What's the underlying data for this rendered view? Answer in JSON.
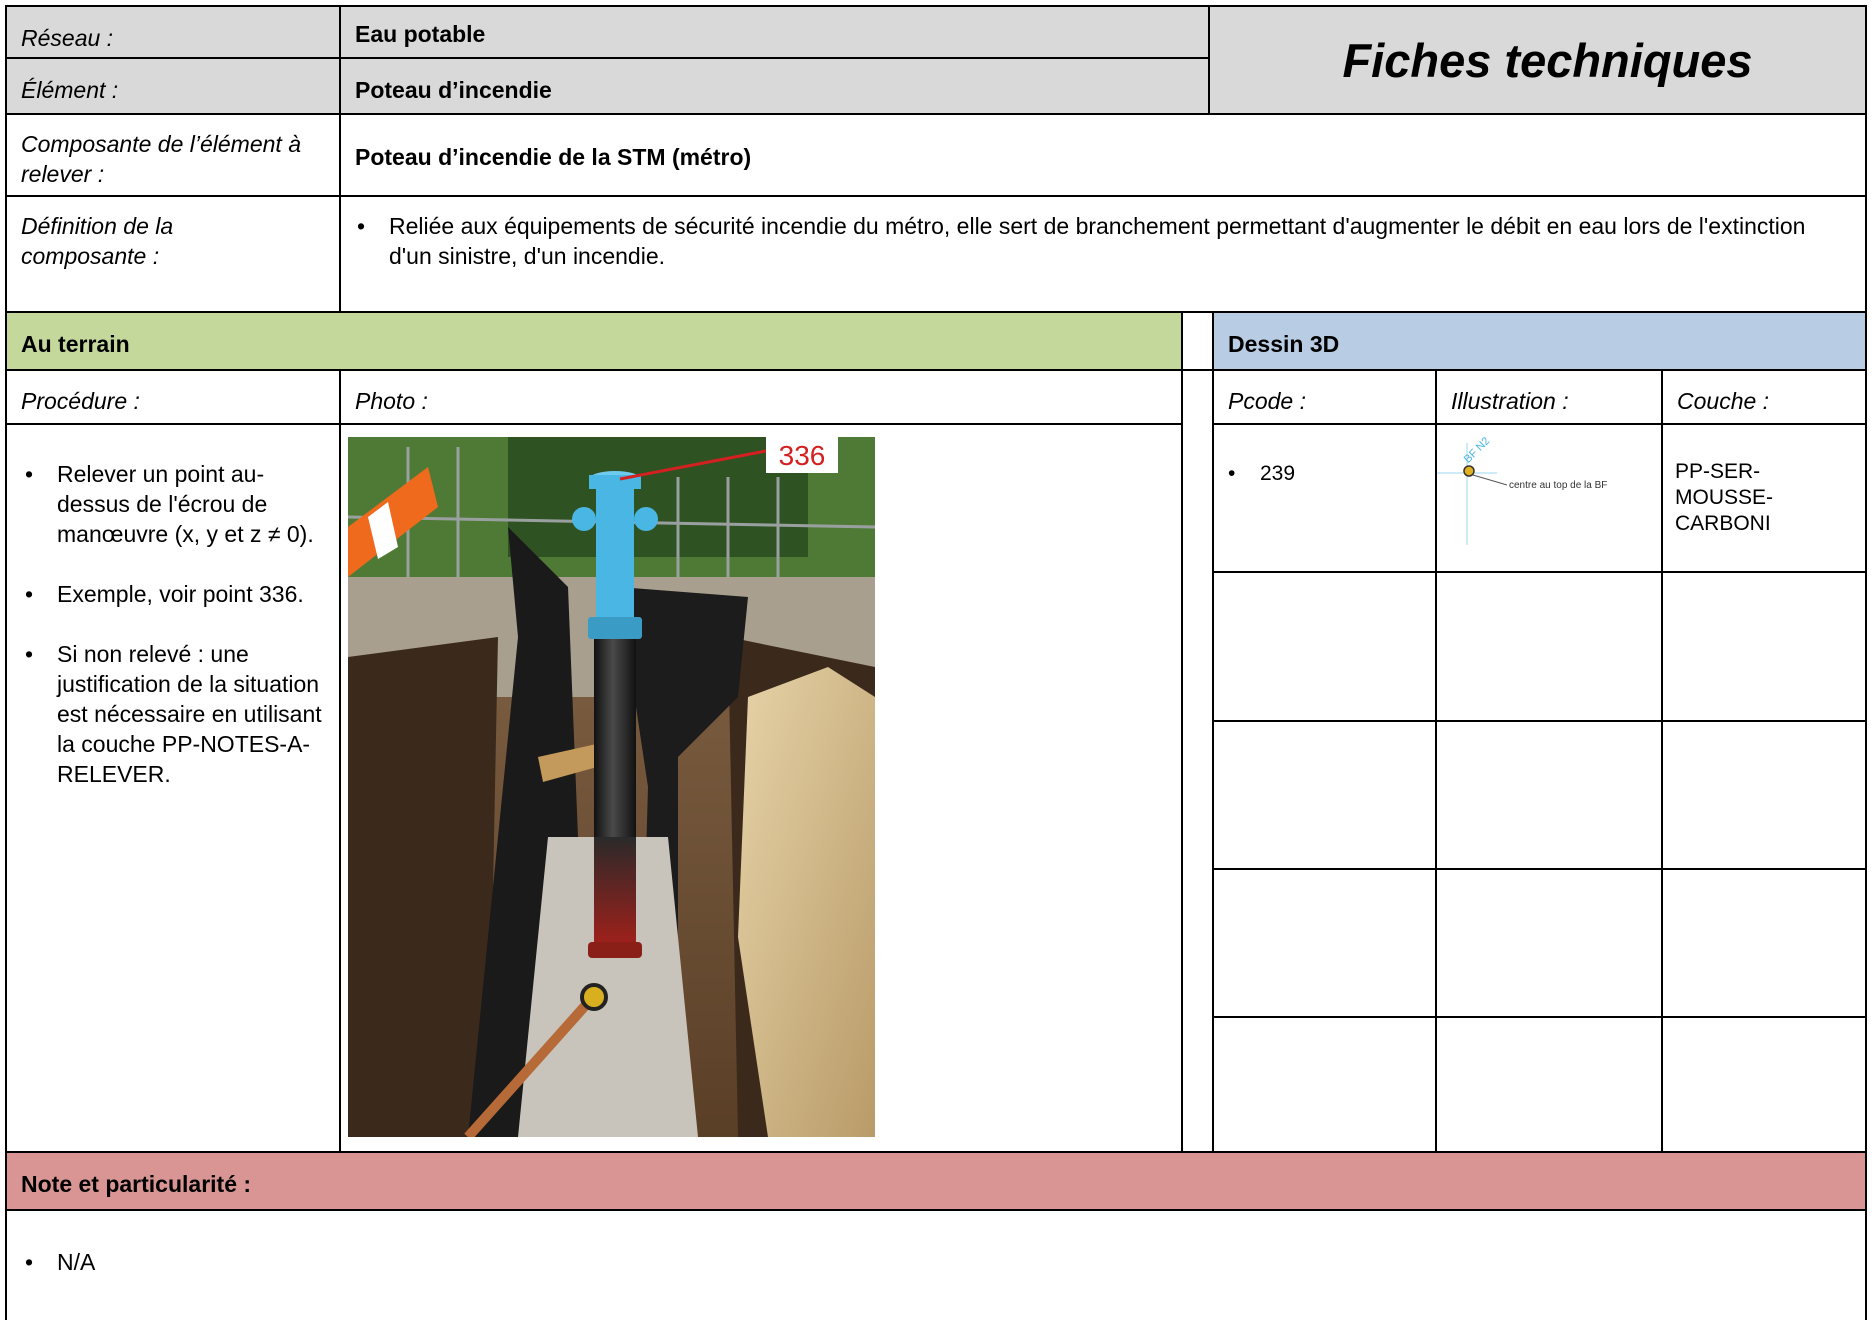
{
  "header": {
    "reseau_label": "Réseau :",
    "reseau_value": "Eau potable",
    "element_label": "Élément :",
    "element_value": "Poteau d’incendie",
    "title": "Fiches techniques"
  },
  "composante": {
    "label": "Composante de l’élément à relever :",
    "value": "Poteau d’incendie de la STM (métro)"
  },
  "definition": {
    "label": "Définition de la composante :",
    "text": "Reliée aux équipements de sécurité incendie du métro, elle sert de branchement permettant d'augmenter le débit en eau lors de l'extinction d'un sinistre, d'un incendie."
  },
  "terrain": {
    "heading": "Au terrain",
    "procedure_label": "Procédure :",
    "photo_label": "Photo :",
    "procedure_items": [
      "Relever un point au-dessus de l'écrou de manœuvre (x, y et z ≠ 0).",
      "Exemple, voir point 336.",
      "Si non relevé : une justification de la situation est nécessaire en utilisant la couche PP-NOTES-A-RELEVER."
    ],
    "photo_point_label": "336"
  },
  "dessin": {
    "heading": "Dessin 3D",
    "pcode_label": "Pcode :",
    "illustration_label": "Illustration :",
    "couche_label": "Couche :",
    "row1": {
      "pcode": "239",
      "illustration_caption": "centre au top de la BF",
      "illustration_tag": "BF N2",
      "couche": "PP-SER-MOUSSE-CARBONI"
    }
  },
  "note": {
    "heading": "Note et particularité :",
    "items": [
      "N/A"
    ]
  },
  "colors": {
    "gray_header": "#d9d9d9",
    "green_header": "#c4d89b",
    "blue_header": "#b8cce4",
    "red_header": "#d99594",
    "photo_label_red": "#d42020",
    "hydrant_blue": "#49b6e3"
  }
}
